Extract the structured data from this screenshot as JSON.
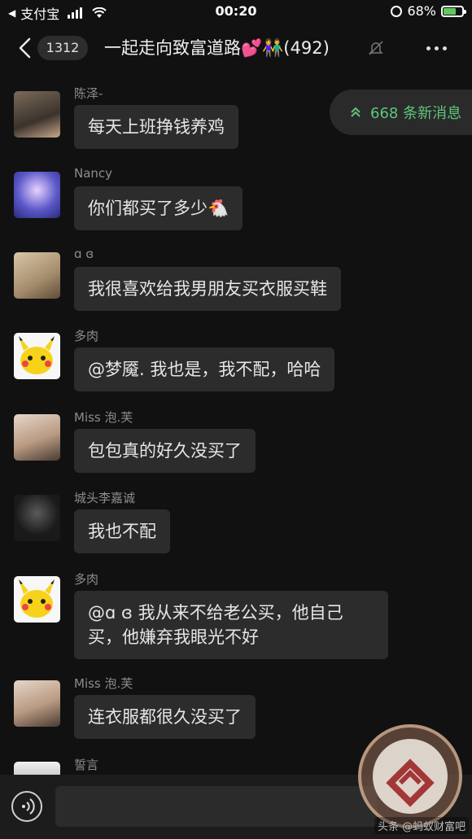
{
  "status_bar": {
    "back_app": "支付宝",
    "time": "00:20",
    "battery": "68%",
    "battery_level": 0.68
  },
  "navbar": {
    "unread_count": "1312",
    "group_title": "一起走向致富道路💕👫(492)"
  },
  "new_messages": {
    "label": "668 条新消息"
  },
  "messages": [
    {
      "sender": "陈泽-",
      "text": "每天上班挣钱养鸡"
    },
    {
      "sender": "Nancy",
      "text": "你们都买了多少🐔"
    },
    {
      "sender": "ɑ ɞ",
      "text": "我很喜欢给我男朋友买衣服买鞋"
    },
    {
      "sender": "多肉",
      "text": "@梦魇. 我也是，我不配，哈哈"
    },
    {
      "sender": "Miss  泡.芙",
      "text": "包包真的好久没买了"
    },
    {
      "sender": "城头李嘉诚",
      "text": "我也不配"
    },
    {
      "sender": "多肉",
      "text": "@ɑ ɞ 我从来不给老公买，他自己买，他嫌弃我眼光不好"
    },
    {
      "sender": "Miss  泡.芙",
      "text": "连衣服都很久没买了"
    },
    {
      "sender": "誓言",
      "text": ""
    }
  ],
  "watermark": {
    "caption": "头条 @蚂蚁财富吧"
  },
  "colors": {
    "background": "#111111",
    "bubble": "#2c2c2c",
    "accent_green": "#5fc57a",
    "sender_gray": "#8d8d8d"
  }
}
